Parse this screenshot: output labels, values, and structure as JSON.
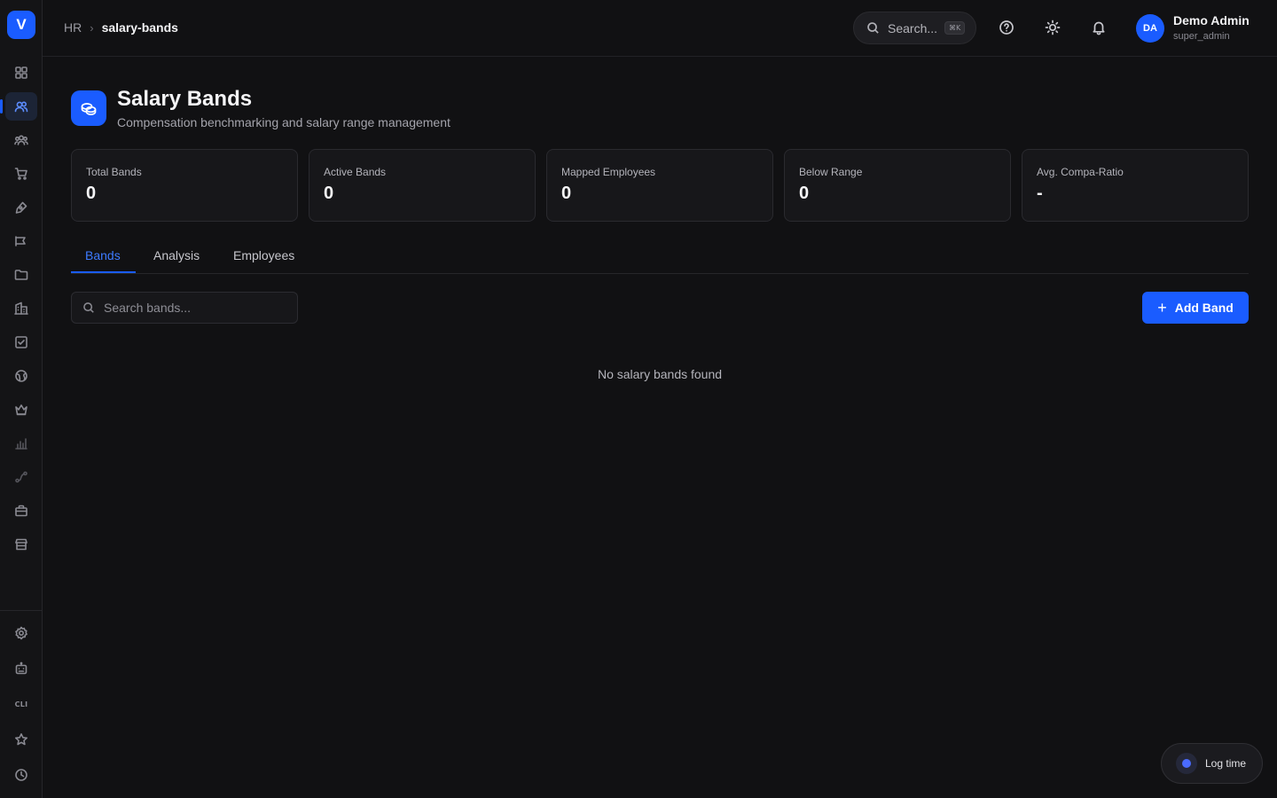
{
  "app": {
    "logo_letter": "V"
  },
  "sidebar": {
    "items": [
      {
        "name": "dashboard-icon"
      },
      {
        "name": "users-icon",
        "active": true
      },
      {
        "name": "team-icon"
      },
      {
        "name": "cart-icon"
      },
      {
        "name": "pen-tool-icon"
      },
      {
        "name": "megaphone-icon"
      },
      {
        "name": "folder-icon"
      },
      {
        "name": "building-icon"
      },
      {
        "name": "checkbox-icon"
      },
      {
        "name": "globe-icon"
      },
      {
        "name": "crown-icon"
      },
      {
        "name": "bar-chart-icon"
      },
      {
        "name": "route-icon"
      },
      {
        "name": "briefcase-icon"
      },
      {
        "name": "store-icon"
      }
    ],
    "bottom_items": [
      {
        "name": "settings-icon"
      },
      {
        "name": "robot-icon"
      },
      {
        "name": "cli-icon",
        "label": "CLI"
      },
      {
        "name": "star-icon"
      },
      {
        "name": "clock-icon"
      }
    ]
  },
  "breadcrumb": {
    "parent": "HR",
    "separator": "›",
    "current": "salary-bands"
  },
  "topbar": {
    "search_label": "Search...",
    "search_shortcut": "⌘K",
    "user": {
      "initials": "DA",
      "name": "Demo Admin",
      "role": "super_admin"
    }
  },
  "page": {
    "title": "Salary Bands",
    "subtitle": "Compensation benchmarking and salary range management"
  },
  "stats": [
    {
      "label": "Total Bands",
      "value": "0"
    },
    {
      "label": "Active Bands",
      "value": "0"
    },
    {
      "label": "Mapped Employees",
      "value": "0"
    },
    {
      "label": "Below Range",
      "value": "0"
    },
    {
      "label": "Avg. Compa-Ratio",
      "value": "-"
    }
  ],
  "tabs": [
    {
      "label": "Bands",
      "active": true
    },
    {
      "label": "Analysis"
    },
    {
      "label": "Employees"
    }
  ],
  "bands": {
    "search_placeholder": "Search bands...",
    "add_label": "Add Band",
    "empty_message": "No salary bands found"
  },
  "log_time": {
    "label": "Log time"
  },
  "colors": {
    "accent": "#1a5cff",
    "background": "#111113",
    "card": "#17171a"
  }
}
